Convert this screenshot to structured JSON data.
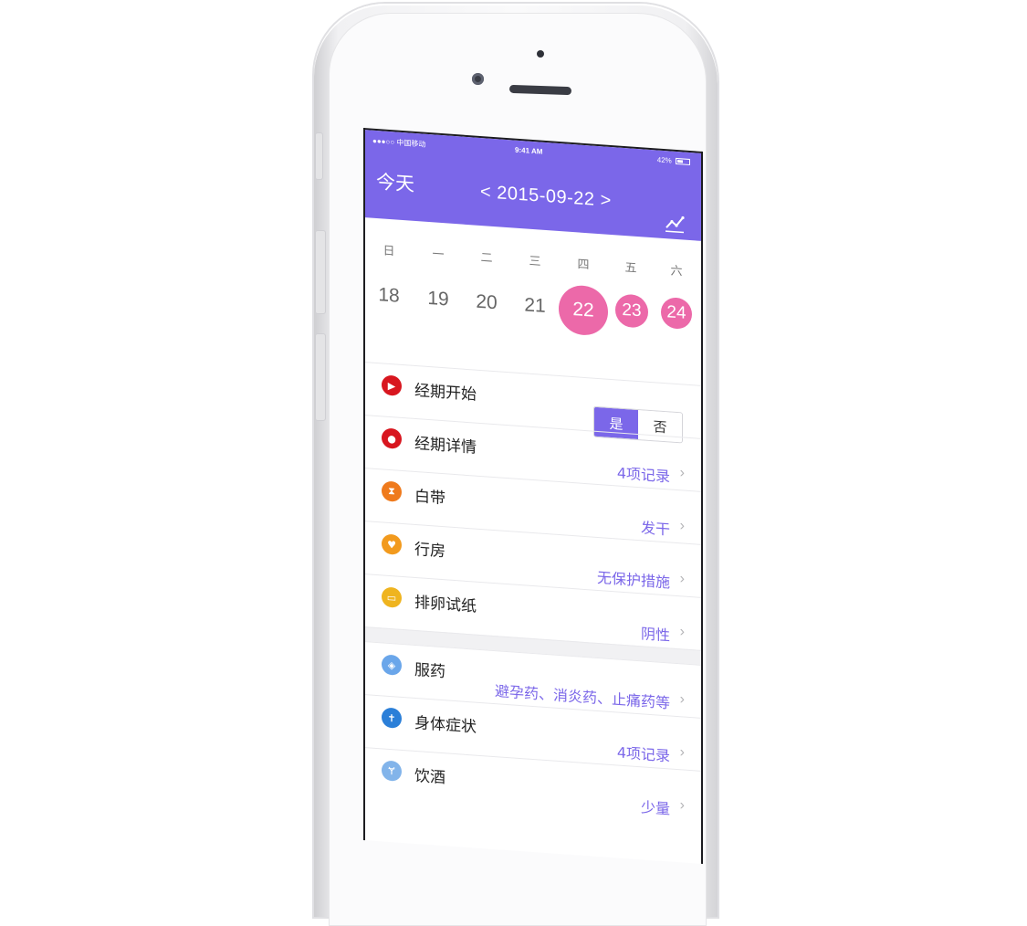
{
  "status": {
    "carrier": "●●●○○ 中国移动",
    "time": "9:41 AM",
    "battery": "42%"
  },
  "header": {
    "today_label": "今天",
    "date_label": "< 2015-09-22 >"
  },
  "week": {
    "weekdays": [
      "日",
      "一",
      "二",
      "三",
      "四",
      "五",
      "六"
    ],
    "days": [
      "18",
      "19",
      "20",
      "21",
      "22",
      "23",
      "24"
    ],
    "selected_days": [
      "22",
      "23",
      "24"
    ]
  },
  "records": {
    "period_start": {
      "label": "经期开始",
      "yes": "是",
      "no": "否"
    },
    "period_detail": {
      "label": "经期详情",
      "value": "4项记录"
    },
    "discharge": {
      "label": "白带",
      "value": "发干"
    },
    "intercourse": {
      "label": "行房",
      "value": "无保护措施"
    },
    "ovulation_test": {
      "label": "排卵试纸",
      "value": "阴性"
    },
    "medication": {
      "label": "服药",
      "value": "避孕药、消炎药、止痛药等"
    },
    "symptoms": {
      "label": "身体症状",
      "value": "4项记录"
    },
    "drinking": {
      "label": "饮酒",
      "value": "少量"
    }
  },
  "colors": {
    "accent": "#7b67e9",
    "highlight": "#ec69a9"
  }
}
